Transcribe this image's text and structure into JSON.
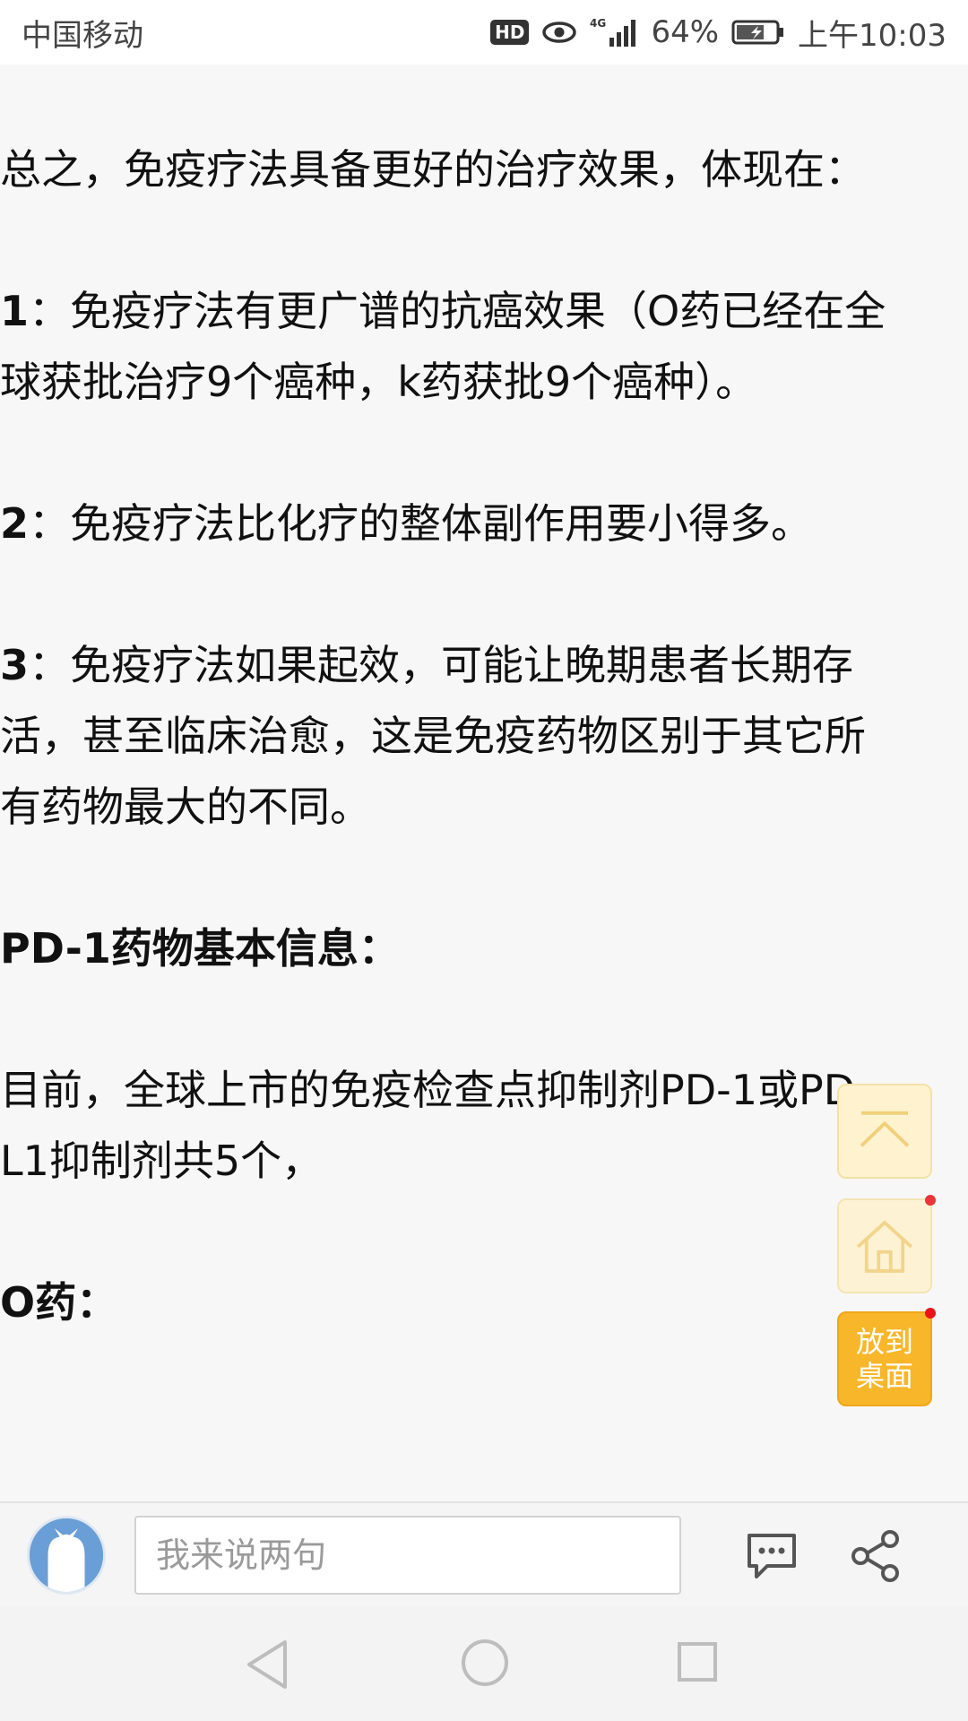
{
  "status_bar": {
    "carrier": "中国移动",
    "hd_badge": "HD",
    "network": "4G",
    "battery_percent": "64%",
    "time": "上午10:03",
    "icons": [
      "hd-icon",
      "eye-icon",
      "signal-icon",
      "battery-charging-icon"
    ]
  },
  "article": {
    "intro": "总之，免疫疗法具备更好的治疗效果，体现在：",
    "points": [
      {
        "num": "1",
        "sep": "：",
        "text": "免疫疗法有更广谱的抗癌效果（O药已经在全球获批治疗9个癌种，k药获批9个癌种）。"
      },
      {
        "num": "2",
        "sep": "：",
        "text": "免疫疗法比化疗的整体副作用要小得多。"
      },
      {
        "num": "3",
        "sep": "：",
        "text": "免疫疗法如果起效，可能让晚期患者长期存活，甚至临床治愈，这是免疫药物区别于其它所有药物最大的不同。"
      }
    ],
    "heading": "PD-1药物基本信息：",
    "body": "目前，全球上市的免疫检查点抑制剂PD-1或PD-L1抑制剂共5个，",
    "next_heading": "O药："
  },
  "floating": {
    "top_icon": "back-to-top-icon",
    "home_icon": "home-icon",
    "desk_line1": "放到",
    "desk_line2": "桌面"
  },
  "comment_bar": {
    "placeholder": "我来说两句",
    "icons": [
      "avatar",
      "comment-icon",
      "share-icon"
    ]
  },
  "nav": {
    "icons": [
      "back-icon",
      "home-circle-icon",
      "recent-apps-icon"
    ]
  },
  "colors": {
    "accent_orange": "#f8b62a",
    "float_bg": "#fff3cf",
    "red_dot": "#e8141a",
    "avatar_blue": "#6a9ed6"
  }
}
